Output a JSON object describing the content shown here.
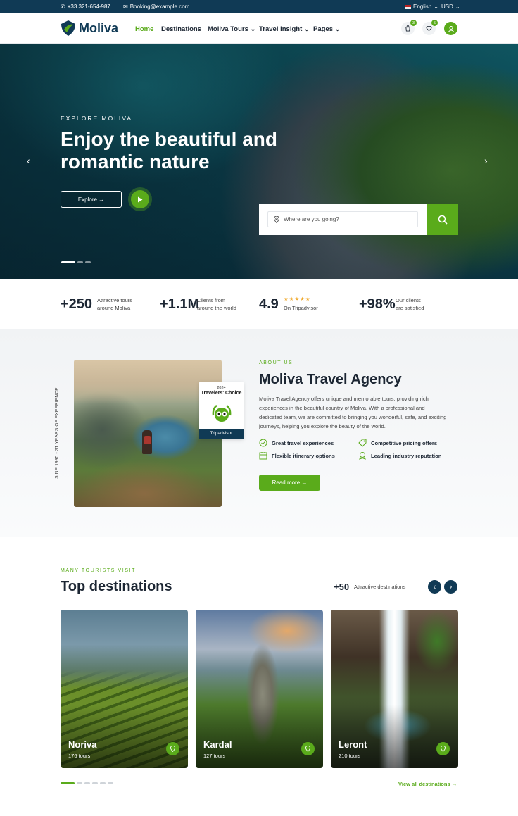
{
  "topbar": {
    "phone": "+33 321-654-987",
    "email": "Booking@example.com",
    "language": "English",
    "currency": "USD"
  },
  "nav": {
    "brand": "Moliva",
    "links": [
      "Home",
      "Destinations",
      "Moliva Tours",
      "Travel Insight",
      "Pages"
    ],
    "cart_count": "3",
    "wishlist_count": "5"
  },
  "hero": {
    "eyebrow": "EXPLORE MOLIVA",
    "title": "Enjoy the beautiful and romantic nature",
    "explore_label": "Explore →",
    "search_placeholder": "Where are you going?"
  },
  "stats": [
    {
      "num": "+250",
      "label1": "Attractive tours",
      "label2": "around Moliva"
    },
    {
      "num": "+1.1M",
      "label1": "Clients from",
      "label2": "around the world"
    },
    {
      "num": "4.9",
      "label1": "★★★★★",
      "label2": "On Tripadvisor"
    },
    {
      "num": "+98%",
      "label1": "Our clients",
      "label2": "are satisfied"
    }
  ],
  "about": {
    "side_text": "SINE 1995 - 31 YEARS OF EXPERIENCE",
    "award_year": "2024",
    "award_title": "Travelers' Choice",
    "award_brand": "Tripadvisor",
    "eyebrow": "ABOUT US",
    "title": "Moliva Travel Agency",
    "description": "Moliva Travel Agency offers unique and memorable tours, providing rich experiences in the beautiful country of Moliva. With a professional and dedicated team, we are committed to bringing you wonderful, safe, and exciting journeys, helping you explore the beauty of the world.",
    "features": [
      "Great travel experiences",
      "Competitive pricing offers",
      "Flexible itinerary options",
      "Leading industry reputation"
    ],
    "read_more": "Read more →"
  },
  "destinations": {
    "eyebrow": "MANY TOURISTS VISIT",
    "title": "Top destinations",
    "count": "+50",
    "count_label": "Attractive destinations",
    "cards": [
      {
        "name": "Noriva",
        "tours": "176 tours"
      },
      {
        "name": "Kardal",
        "tours": "127 tours"
      },
      {
        "name": "Leront",
        "tours": "210 tours"
      }
    ],
    "view_all": "View all destinations →"
  },
  "colors": {
    "primary": "#5aab1b",
    "dark": "#103a55"
  }
}
